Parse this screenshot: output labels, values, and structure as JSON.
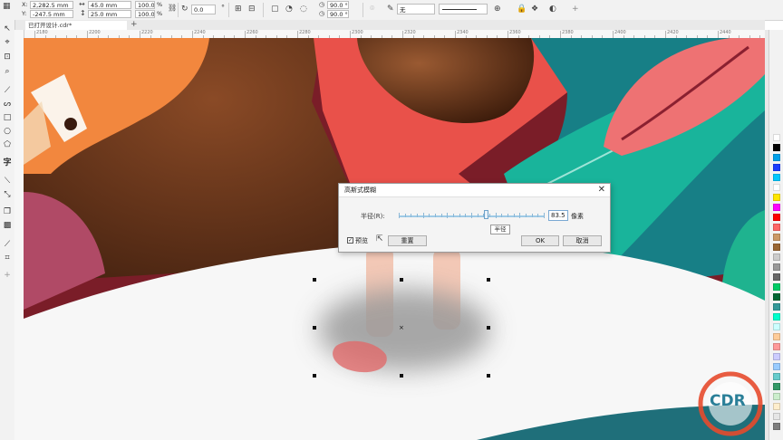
{
  "property_bar": {
    "x_label": "X:",
    "x_value": "2,282.5 mm",
    "y_label": "Y:",
    "y_value": "-247.5 mm",
    "width_value": "45.0 mm",
    "height_value": "25.0 mm",
    "scale_x": "100.0",
    "scale_y": "100.0",
    "percent": "%",
    "rotation": "0.0",
    "corner_1": "90.0 °",
    "corner_2": "90.0 °",
    "outline_none": "无"
  },
  "tabs": {
    "document_tab": "已打开设计.cdr*"
  },
  "dialog": {
    "title": "高斯式模糊",
    "radius_label": "半径(R):",
    "radius_value": "83.5",
    "unit": "像素",
    "tooltip": "半径",
    "preview_label": "预览",
    "preview_checked": "✓",
    "reset_label": "重置",
    "ok_label": "OK",
    "cancel_label": "取消",
    "slider_level_fraction": 0.6
  },
  "palette": {
    "colors": [
      "#ffffff",
      "#000000",
      "#00a0e9",
      "#1a3cff",
      "#00c8ff",
      "#ffffff",
      "#ffe600",
      "#ff00ff",
      "#ff0000",
      "#ff6666",
      "#cc9966",
      "#996633",
      "#cccccc",
      "#999999",
      "#666666",
      "#00cc66",
      "#006633",
      "#339999",
      "#00ffcc",
      "#ccffff",
      "#ffcc99",
      "#ff9999",
      "#ccccff",
      "#99ccff",
      "#66cccc",
      "#339966",
      "#cceecc",
      "#ffeecc",
      "#e6e6e6",
      "#7f7f7f"
    ]
  },
  "ruler": {
    "top_numbers": [
      "2180",
      "2200",
      "2220",
      "2240",
      "2260",
      "2280",
      "2300",
      "2320",
      "2340",
      "2360",
      "2380",
      "2400",
      "2420",
      "2440"
    ]
  },
  "watermark": {
    "text": "CDR"
  }
}
